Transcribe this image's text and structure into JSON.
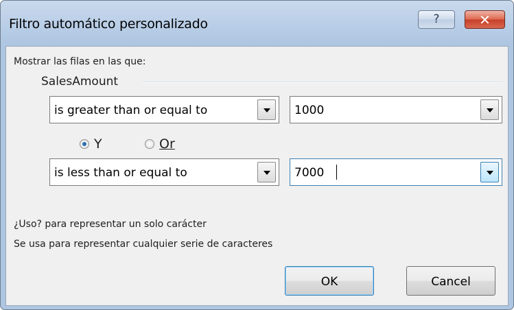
{
  "dialog": {
    "title": "Filtro automático personalizado",
    "help_label": "?",
    "close_label": "✕"
  },
  "filter": {
    "show_rows_label": "Mostrar las filas en las que:",
    "field_name": "SalesAmount",
    "condition1": {
      "operator": "is greater than or equal to",
      "value": "1000"
    },
    "logic": {
      "and_label": "Y",
      "or_label": "Or",
      "selected": "and"
    },
    "condition2": {
      "operator": "is less than or equal to",
      "value": "7000"
    }
  },
  "hints": {
    "single_char": "¿Uso? para representar un solo carácter",
    "any_series": "Se usa para representar cualquier serie de caracteres"
  },
  "buttons": {
    "ok": "OK",
    "cancel": "Cancel"
  }
}
